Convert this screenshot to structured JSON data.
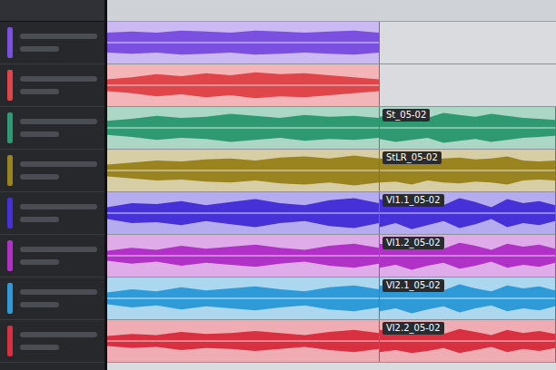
{
  "tracks": [
    {
      "color": "#7b4fe0",
      "clips": [
        {
          "wave": [
            0.5,
            0.55,
            0.5,
            0.6,
            0.55,
            0.5,
            0.6,
            0.55,
            0.5,
            0.55,
            0.6,
            0.5
          ]
        }
      ]
    },
    {
      "color": "#e0454a",
      "clips": [
        {
          "wave": [
            0.3,
            0.4,
            0.55,
            0.45,
            0.6,
            0.5,
            0.65,
            0.55,
            0.6,
            0.5,
            0.4,
            0.3
          ]
        }
      ]
    },
    {
      "color": "#2f9a72",
      "clips": [
        {
          "wave": [
            0.35,
            0.45,
            0.6,
            0.5,
            0.55,
            0.7,
            0.6,
            0.5,
            0.65,
            0.55,
            0.6,
            0.5
          ]
        },
        {
          "label": "St_05-02",
          "wave": [
            0.55,
            0.7,
            0.6,
            0.5,
            0.75,
            0.65,
            0.55,
            0.7,
            0.6,
            0.5,
            0.45,
            0.4
          ]
        }
      ]
    },
    {
      "color": "#9a8420",
      "clips": [
        {
          "wave": [
            0.3,
            0.4,
            0.5,
            0.45,
            0.55,
            0.6,
            0.5,
            0.65,
            0.7,
            0.6,
            0.75,
            0.6
          ]
        },
        {
          "label": "StLR_05-02",
          "wave": [
            0.6,
            0.55,
            0.7,
            0.5,
            0.6,
            0.65,
            0.55,
            0.6,
            0.7,
            0.5,
            0.45,
            0.5
          ]
        }
      ]
    },
    {
      "color": "#4630d8",
      "clips": [
        {
          "wave": [
            0.3,
            0.5,
            0.45,
            0.6,
            0.4,
            0.55,
            0.7,
            0.5,
            0.4,
            0.65,
            0.75,
            0.5
          ]
        },
        {
          "label": "Vl1.1_05-02",
          "wave": [
            0.7,
            0.5,
            0.8,
            0.6,
            0.4,
            0.75,
            0.55,
            0.3,
            0.7,
            0.5,
            0.6,
            0.4
          ]
        }
      ]
    },
    {
      "color": "#b030c8",
      "clips": [
        {
          "wave": [
            0.25,
            0.4,
            0.3,
            0.5,
            0.35,
            0.45,
            0.55,
            0.4,
            0.3,
            0.5,
            0.6,
            0.4
          ]
        },
        {
          "label": "Vl1.2_05-02",
          "wave": [
            0.6,
            0.45,
            0.7,
            0.5,
            0.35,
            0.65,
            0.5,
            0.3,
            0.6,
            0.45,
            0.55,
            0.35
          ]
        }
      ]
    },
    {
      "color": "#2f9ad8",
      "clips": [
        {
          "wave": [
            0.3,
            0.45,
            0.35,
            0.55,
            0.4,
            0.5,
            0.6,
            0.45,
            0.35,
            0.55,
            0.65,
            0.45
          ]
        },
        {
          "label": "Vl2.1_05-02",
          "wave": [
            0.65,
            0.5,
            0.75,
            0.55,
            0.4,
            0.7,
            0.5,
            0.35,
            0.65,
            0.5,
            0.6,
            0.4
          ]
        }
      ]
    },
    {
      "color": "#d83040",
      "clips": [
        {
          "wave": [
            0.25,
            0.35,
            0.3,
            0.45,
            0.35,
            0.4,
            0.5,
            0.4,
            0.3,
            0.45,
            0.55,
            0.4
          ]
        },
        {
          "label": "Vl2.2_05-02",
          "wave": [
            0.55,
            0.45,
            0.6,
            0.5,
            0.35,
            0.6,
            0.45,
            0.3,
            0.55,
            0.4,
            0.5,
            0.35
          ]
        }
      ]
    }
  ]
}
